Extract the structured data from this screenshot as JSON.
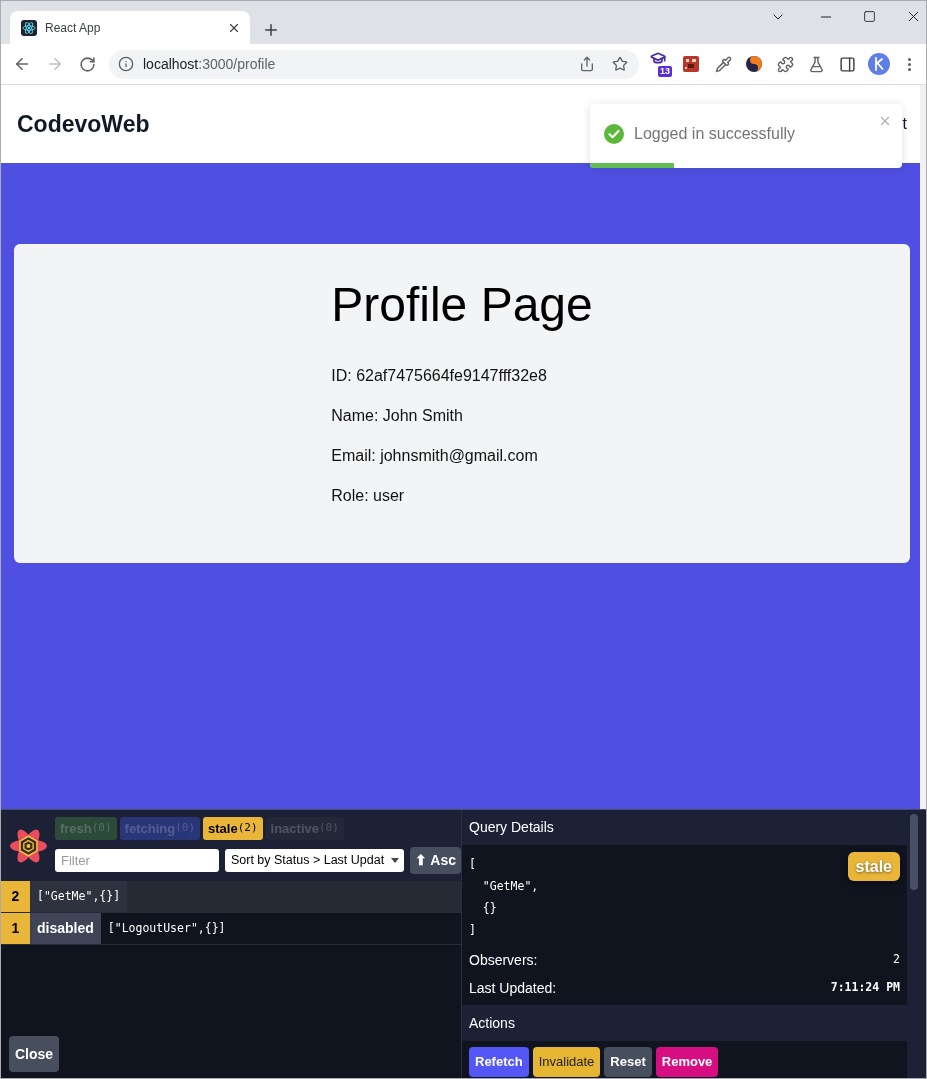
{
  "browser": {
    "tab": {
      "title": "React App",
      "selected": true
    },
    "address": {
      "host": "localhost",
      "path": ":3000/profile"
    },
    "extension_badge": "13"
  },
  "header": {
    "brand": "CodevoWeb",
    "nav_text": "t"
  },
  "toast": {
    "message": "Logged in successfully",
    "level": 0.27
  },
  "profile": {
    "title": "Profile Page",
    "lines": [
      "ID: 62af7475664fe9147fff32e8",
      "Name: John Smith",
      "Email: johnsmith@gmail.com",
      "Role: user"
    ]
  },
  "devtools": {
    "status_filters": [
      {
        "label": "fresh",
        "count": "(0)",
        "dimmed": true,
        "color": "#2c4a3a"
      },
      {
        "label": "fetching",
        "count": "(0)",
        "dimmed": true,
        "color": "#283577"
      },
      {
        "label": "stale",
        "count": "(2)",
        "dimmed": false,
        "color": "#e9b63a"
      },
      {
        "label": "inactive",
        "count": "(0)",
        "dimmed": true,
        "color": "#222838"
      }
    ],
    "filter": {
      "placeholder": "Filter"
    },
    "sort": {
      "value": "Sort by Status > Last Updat"
    },
    "order_button": "⬆ Asc",
    "queries": [
      {
        "observers": "2",
        "key": "[\"GetMe\",{}]",
        "selected": true
      },
      {
        "observers": "1",
        "tag": "disabled",
        "key": "[\"LogoutUser\",{}]",
        "selected": false
      }
    ],
    "close_button": "Close",
    "details": {
      "title": "Query Details",
      "key_lines": [
        "[",
        "  \"GetMe\",",
        "  {}",
        "]"
      ],
      "status": {
        "label": "stale",
        "color": "#e9b63a"
      },
      "observers_label": "Observers:",
      "observers": "2",
      "updated_label": "Last Updated:",
      "updated": "7:11:24 PM"
    },
    "actions": {
      "title": "Actions",
      "buttons": [
        {
          "label": "Refetch",
          "color": "#5457f5"
        },
        {
          "label": "Invalidate",
          "color": "#e6b532"
        },
        {
          "label": "Reset",
          "color": "#474e5e"
        },
        {
          "label": "Remove",
          "color": "#d70e82"
        }
      ]
    }
  }
}
